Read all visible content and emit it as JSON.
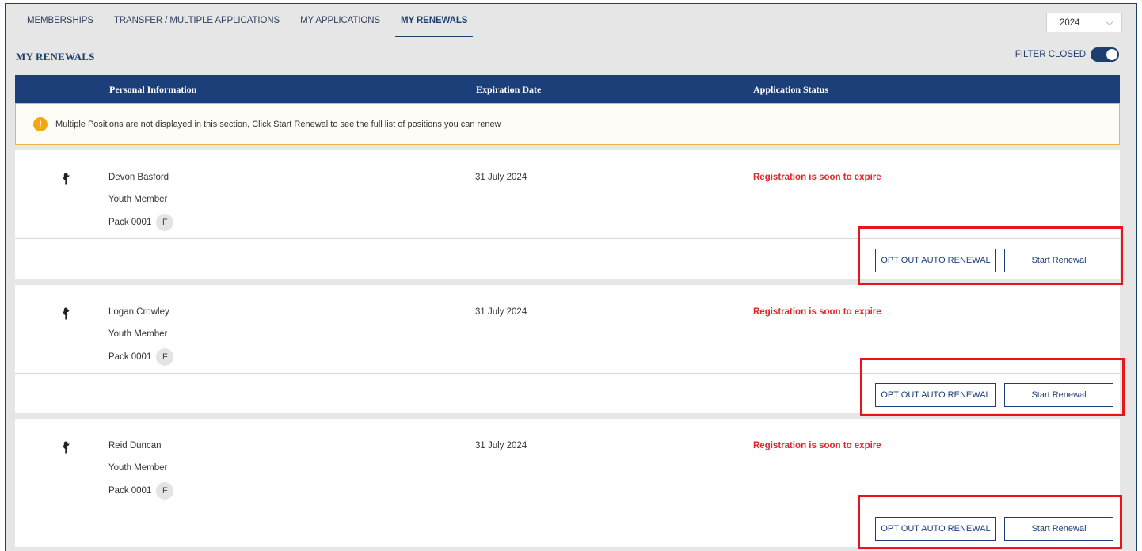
{
  "tabs": [
    {
      "label": "MEMBERSHIPS",
      "active": false
    },
    {
      "label": "TRANSFER / MULTIPLE APPLICATIONS",
      "active": false
    },
    {
      "label": "MY APPLICATIONS",
      "active": false
    },
    {
      "label": "MY RENEWALS",
      "active": true
    }
  ],
  "year_select": {
    "value": "2024"
  },
  "section_title": "MY RENEWALS",
  "filter": {
    "label": "FILTER CLOSED",
    "on": true
  },
  "table": {
    "headers": [
      "Personal Information",
      "Expiration Date",
      "Application Status"
    ]
  },
  "notice": {
    "icon": "warning-icon",
    "text": "Multiple Positions are not displayed in this section, Click Start Renewal to see the full list of positions you can renew"
  },
  "renewals": [
    {
      "name": "Devon Basford",
      "role": "Youth Member",
      "unit": "Pack 0001",
      "badge": "F",
      "expiration": "31 July 2024",
      "status": "Registration is soon to expire",
      "opt_out_label": "OPT OUT AUTO RENEWAL",
      "start_label": "Start Renewal"
    },
    {
      "name": "Logan Crowley",
      "role": "Youth Member",
      "unit": "Pack 0001",
      "badge": "F",
      "expiration": "31 July 2024",
      "status": "Registration is soon to expire",
      "opt_out_label": "OPT OUT AUTO RENEWAL",
      "start_label": "Start Renewal"
    },
    {
      "name": "Reid Duncan",
      "role": "Youth Member",
      "unit": "Pack 0001",
      "badge": "F",
      "expiration": "31 July 2024",
      "status": "Registration is soon to expire",
      "opt_out_label": "OPT OUT AUTO RENEWAL",
      "start_label": "Start Renewal"
    }
  ],
  "colors": {
    "primary": "#1c3f79",
    "alert": "#e0262a",
    "highlight": "#e8141c",
    "notice_border": "#f3b448"
  }
}
